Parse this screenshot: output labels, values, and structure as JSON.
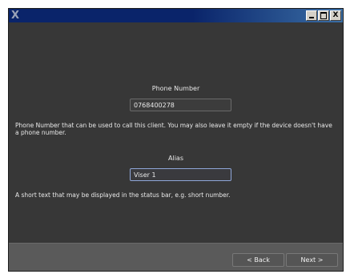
{
  "titlebar": {
    "logo_glyph": "X",
    "minimize_icon": "minimize-icon",
    "maximize_icon": "maximize-icon",
    "close_label": "X"
  },
  "form": {
    "phone": {
      "label": "Phone Number",
      "value": "0768400278",
      "description": "Phone Number that can be used to call this client. You may also leave it empty if the device doesn't have a phone number."
    },
    "alias": {
      "label": "Alias",
      "value": "Viser 1",
      "description": "A short text that may be displayed in the status bar, e.g. short number."
    }
  },
  "footer": {
    "back_label": "< Back",
    "next_label": "Next >"
  },
  "colors": {
    "window_bg": "#383838",
    "titlebar": "#0a246a",
    "footer_bg": "#5a5a5a",
    "text": "#e8e8e8"
  }
}
